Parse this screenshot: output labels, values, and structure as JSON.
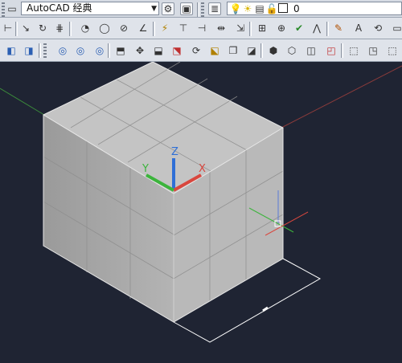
{
  "workspace": {
    "label": "AutoCAD 经典"
  },
  "layer": {
    "current": "0"
  },
  "ucs": {
    "x_label": "X",
    "y_label": "Y",
    "z_label": "Z"
  },
  "colors": {
    "viewport_bg": "#1f2433",
    "cube_top": "#c4c4c4",
    "cube_left": "#a6a6a6",
    "cube_right": "#b9b9b9",
    "axis_x": "#d9473e",
    "axis_y": "#3cb43c",
    "axis_z": "#2f6fd6"
  }
}
